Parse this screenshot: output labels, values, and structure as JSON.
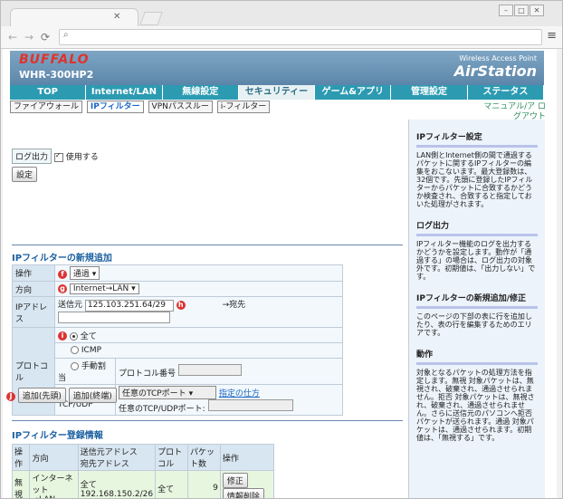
{
  "browser": {
    "address_placeholder": "",
    "win_minimize": "–",
    "win_maximize": "□",
    "win_close": "✕"
  },
  "header": {
    "logo": "BUFFALO",
    "model": "WHR-300HP2",
    "wap": "Wireless Access Point",
    "brand": "AirStation"
  },
  "mainnav": [
    "TOP",
    "Internet/LAN",
    "無線設定",
    "セキュリティー",
    "ゲーム&アプリ",
    "管理設定",
    "ステータス"
  ],
  "subnav": [
    "ファイアウォール",
    "IPフィルター",
    "VPNパススルー",
    "i-フィルター"
  ],
  "manual": "マニュアル/ア ログアウト",
  "log": {
    "label": "ログ出力",
    "checkbox_label": "使用する",
    "set_button": "設定"
  },
  "new_section": {
    "title": "IPフィルターの新規追加",
    "operation_label": "操作",
    "operation_value": "通過",
    "direction_label": "方向",
    "direction_value": "Internet→LAN",
    "ip_label": "IPアドレス",
    "src_label": "送信元",
    "src_value": "125.103.251.64/29",
    "dst_label": "→宛先",
    "protocol_label": "プロトコル",
    "opt_all": "全て",
    "opt_icmp": "ICMP",
    "opt_manual": "手動割当",
    "proto_num_label": "プロトコル番号",
    "opt_tcpudp": "TCP/UDP",
    "tcp_port_select": "任意のTCPポート",
    "spec_link": "指定の仕方",
    "any_port_label": "任意のTCP/UDPポート:",
    "btn_add_first": "追加(先頭)",
    "btn_add_last": "追加(終端)",
    "badges": {
      "f": "f",
      "g": "g",
      "h": "h",
      "i": "i",
      "j": "J"
    }
  },
  "registered": {
    "title": "IPフィルター登録情報",
    "headers": [
      "操作",
      "方向",
      "送信元アドレス\n宛先アドレス",
      "プロトコル",
      "パケット数",
      "操作"
    ],
    "row": {
      "op": "無視",
      "direction": "インターネット\n→LAN",
      "addr": "全て\n192.168.150.2/26",
      "protocol": "全て",
      "packets": "9",
      "btn_edit": "修正",
      "btn_delete": "情報削除"
    }
  },
  "sidebar": {
    "sections": [
      {
        "title": "IPフィルター設定",
        "text": "LAN側とInternet側の間で通過するパケットに関するIPフィルターの編集をおこないます。最大登録数は、32個です。先頭に登録したIPフィルターからパケットに合致するかどうか検査され、合致すると指定しておいた処理がされます。"
      },
      {
        "title": "ログ出力",
        "text": "IPフィルター機能のログを出力するかどうかを設定します。動作が「通過する」の場合は、ログ出力の対象外です。初期値は、「出力しない」です。"
      },
      {
        "title": "IPフィルターの新規追加/修正",
        "text": "このページの下部の表に行を追加したり、表の行を編集するためのエリアです。"
      },
      {
        "title": "動作",
        "text": "対象となるパケットの処理方法を指定します。無視 対象パケットは、無視され、破棄され、通過させられません。拒否 対象パケットは、無視され、破棄され、通過させられません。さらに送信元のパソコンへ拒否パケットが送られます。通過 対象パケットは、通過させられます。初期値は、「無視する」です。"
      }
    ]
  }
}
